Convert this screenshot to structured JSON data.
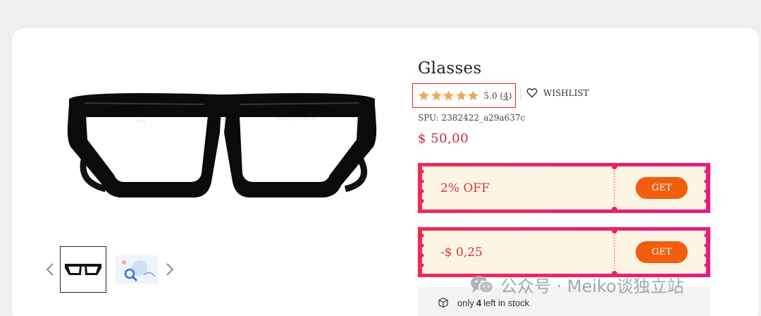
{
  "product": {
    "title": "Glasses",
    "rating_value": "5.0",
    "rating_count_open": "(",
    "rating_count": "4",
    "rating_count_close": ")",
    "stars": 5,
    "wishlist_label": "WISHLIST",
    "spu": "SPU: 2382422_a29a637c",
    "price": "$ 50,00",
    "frame_print": "1439 54□20-145 C01",
    "frame_brand": "Pow"
  },
  "coupons": [
    {
      "label": "2% OFF",
      "button": "GET"
    },
    {
      "label": "-$ 0,25",
      "button": "GET"
    }
  ],
  "stock": {
    "prefix": "only",
    "count": "4",
    "suffix": "left in stock"
  },
  "watermark": "公众号 · Meiko谈独立站",
  "colors": {
    "price": "#c8283c",
    "coupon_button": "#f35d0f",
    "coupon_border": "#ee2266",
    "star": "#f0a75a",
    "highlight_box": "#e8262a"
  },
  "icons": [
    "star-icon",
    "heart-icon",
    "chevron-left-icon",
    "chevron-right-icon",
    "box-icon",
    "wechat-icon"
  ]
}
